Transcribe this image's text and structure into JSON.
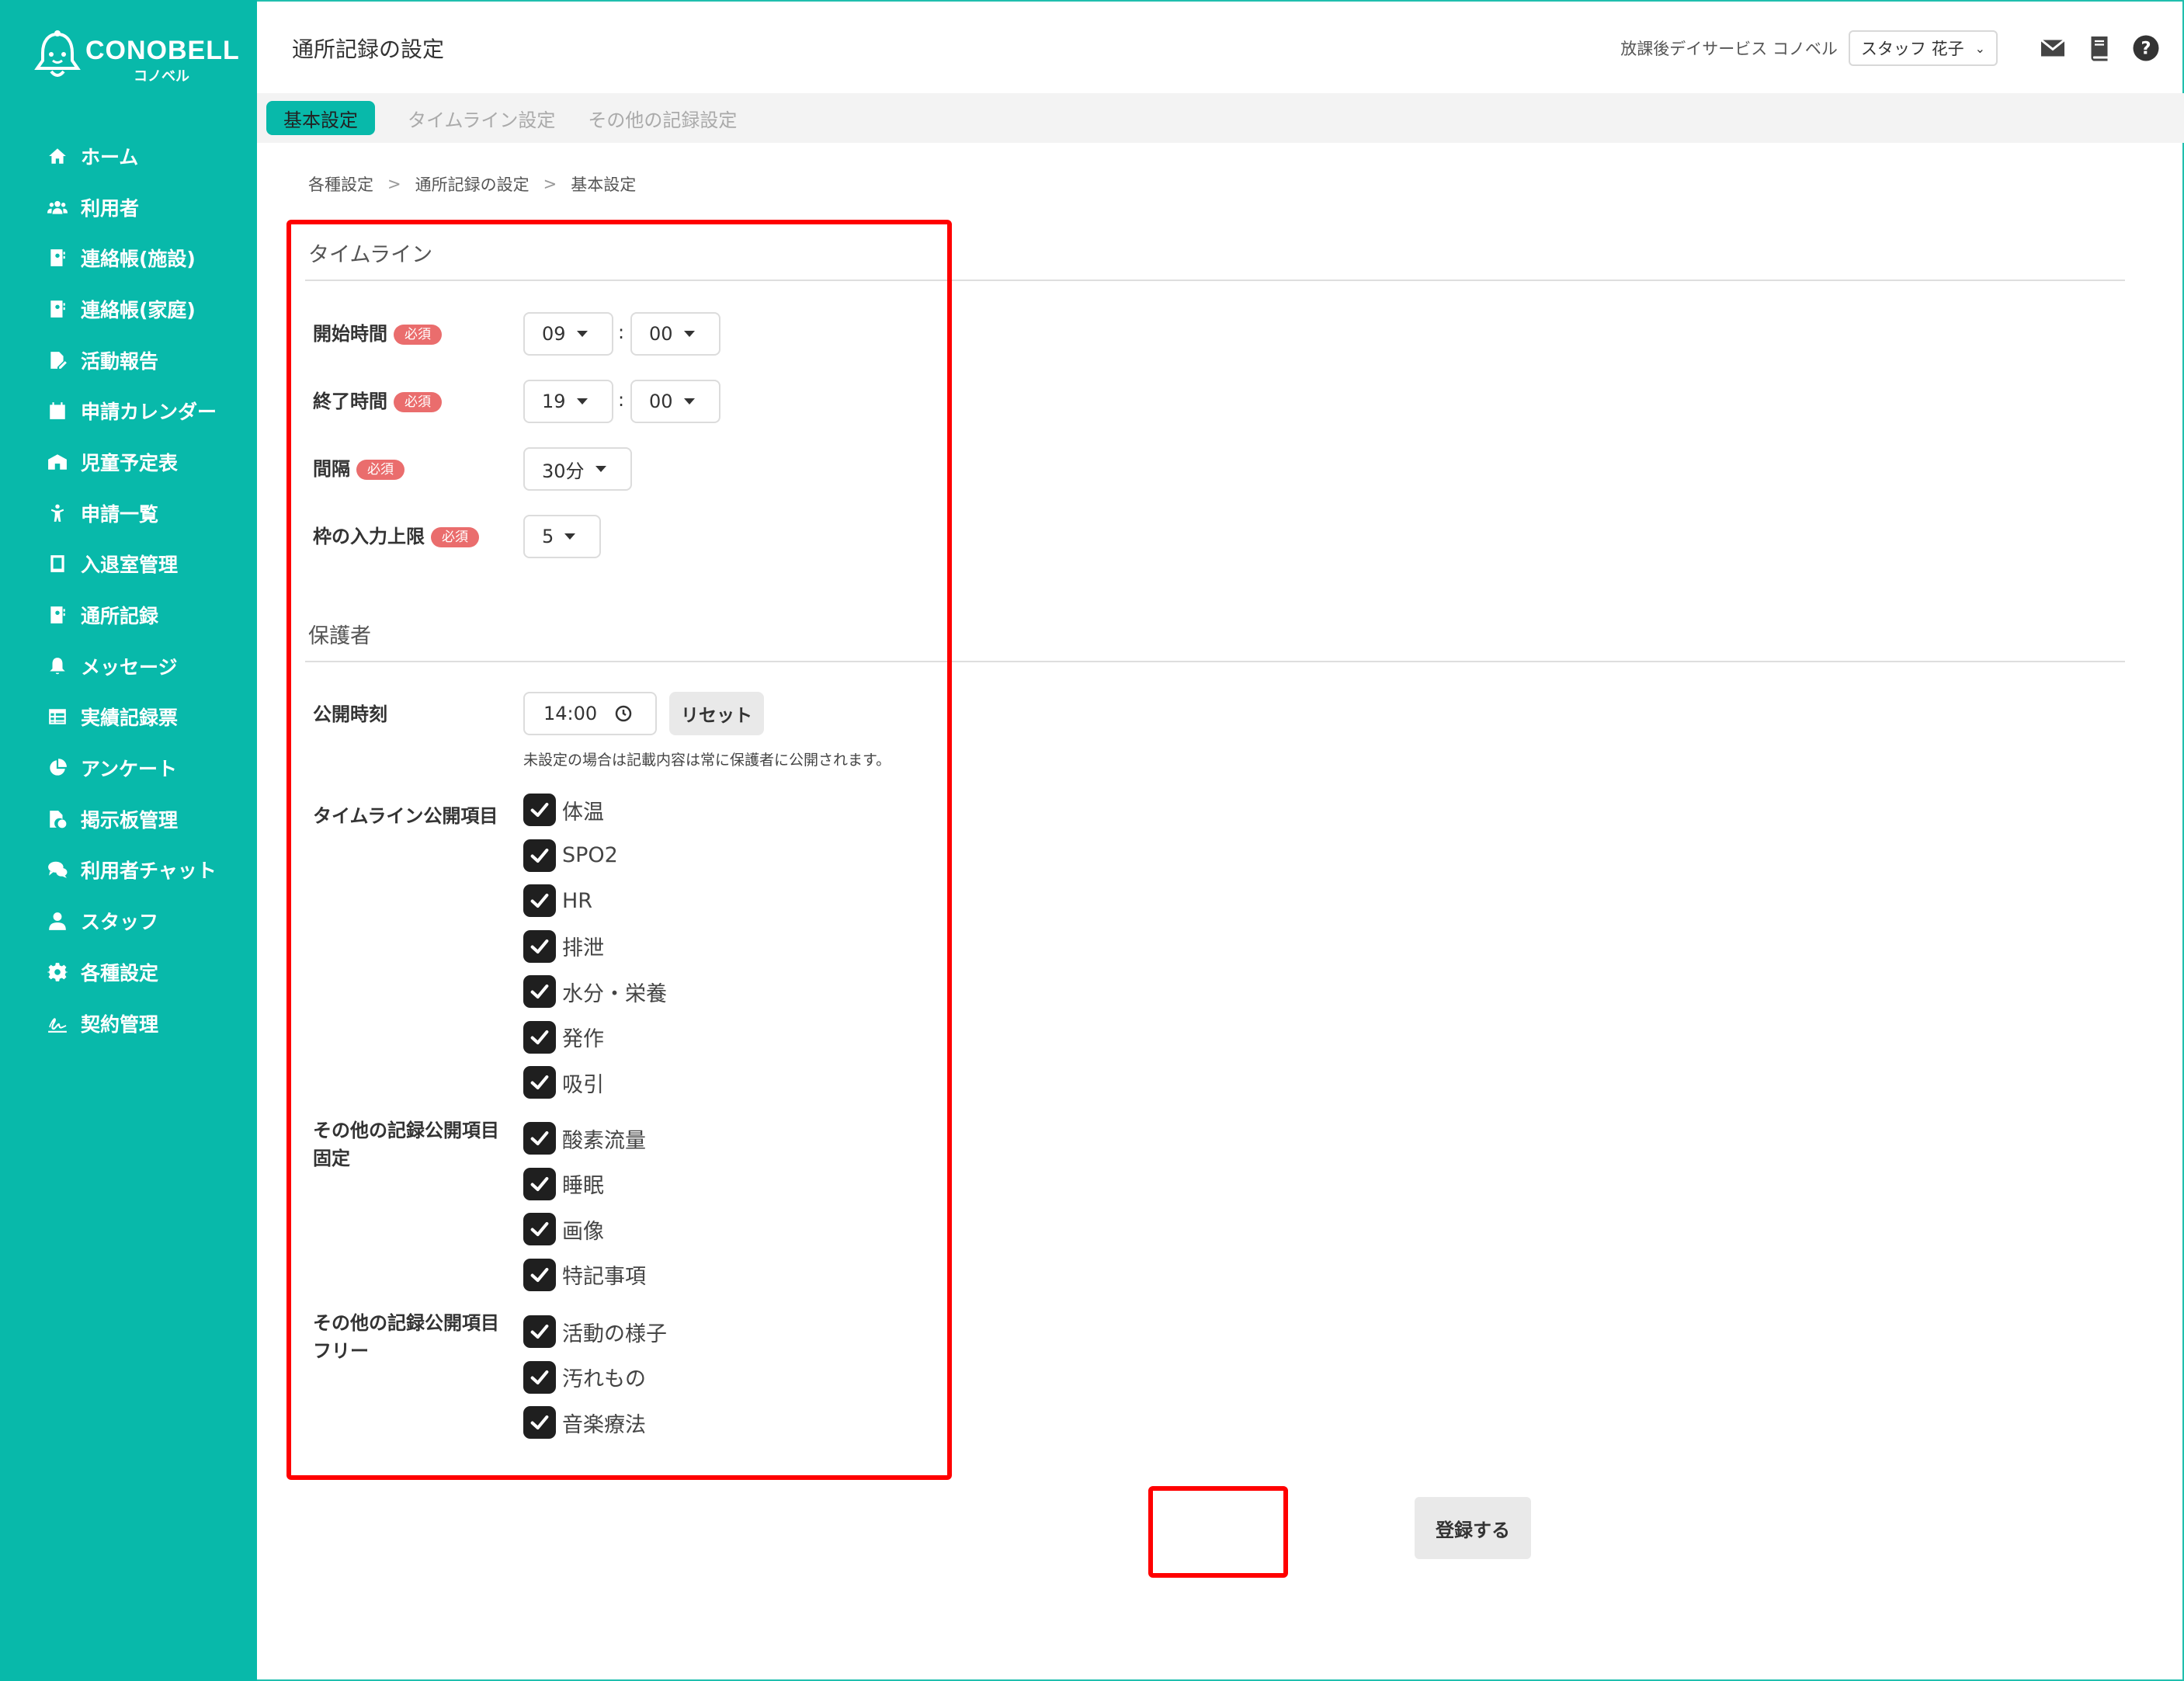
{
  "app": {
    "brand": "CONOBELL",
    "brand_sub": "コノベル",
    "page_title": "通所記録の設定",
    "facility": "放課後デイサービス コノベル",
    "staff": "スタッフ 花子"
  },
  "sidebar": {
    "items": [
      {
        "label": "ホーム",
        "icon": "home-icon"
      },
      {
        "label": "利用者",
        "icon": "users-icon"
      },
      {
        "label": "連絡帳(施設)",
        "icon": "contact-book-icon"
      },
      {
        "label": "連絡帳(家庭)",
        "icon": "contact-book-icon"
      },
      {
        "label": "活動報告",
        "icon": "file-edit-icon"
      },
      {
        "label": "申請カレンダー",
        "icon": "calendar-icon"
      },
      {
        "label": "児童予定表",
        "icon": "building-icon"
      },
      {
        "label": "申請一覧",
        "icon": "child-icon"
      },
      {
        "label": "入退室管理",
        "icon": "tablet-icon"
      },
      {
        "label": "通所記録",
        "icon": "contact-book-icon"
      },
      {
        "label": "メッセージ",
        "icon": "bell-icon"
      },
      {
        "label": "実績記録票",
        "icon": "table-icon"
      },
      {
        "label": "アンケート",
        "icon": "pie-chart-icon"
      },
      {
        "label": "掲示板管理",
        "icon": "file-check-icon"
      },
      {
        "label": "利用者チャット",
        "icon": "chat-icon"
      },
      {
        "label": "スタッフ",
        "icon": "staff-icon"
      },
      {
        "label": "各種設定",
        "icon": "gear-icon"
      },
      {
        "label": "契約管理",
        "icon": "signature-icon"
      }
    ]
  },
  "tabs": [
    {
      "label": "基本設定",
      "active": true
    },
    {
      "label": "タイムライン設定",
      "active": false
    },
    {
      "label": "その他の記録設定",
      "active": false
    }
  ],
  "breadcrumb": [
    "各種設定",
    "通所記録の設定",
    "基本設定"
  ],
  "required_label": "必須",
  "timeline": {
    "section_title": "タイムライン",
    "start_label": "開始時間",
    "start_hour": "09",
    "start_minute": "00",
    "end_label": "終了時間",
    "end_hour": "19",
    "end_minute": "00",
    "interval_label": "間隔",
    "interval_value": "30分",
    "limit_label": "枠の入力上限",
    "limit_value": "5",
    "colon": ":"
  },
  "guardian": {
    "section_title": "保護者",
    "publish_time_label": "公開時刻",
    "publish_time_value": "14:00",
    "reset_label": "リセット",
    "hint": "未設定の場合は記載内容は常に保護者に公開されます。",
    "timeline_items_label": "タイムライン公開項目",
    "timeline_items": [
      {
        "label": "体温",
        "checked": true
      },
      {
        "label": "SPO2",
        "checked": true
      },
      {
        "label": "HR",
        "checked": true
      },
      {
        "label": "排泄",
        "checked": true
      },
      {
        "label": "水分・栄養",
        "checked": true
      },
      {
        "label": "発作",
        "checked": true
      },
      {
        "label": "吸引",
        "checked": true
      }
    ],
    "other_fixed_label_1": "その他の記録公開項目",
    "other_fixed_label_2": "固定",
    "other_fixed_items": [
      {
        "label": "酸素流量",
        "checked": true
      },
      {
        "label": "睡眠",
        "checked": true
      },
      {
        "label": "画像",
        "checked": true
      },
      {
        "label": "特記事項",
        "checked": true
      }
    ],
    "other_free_label_1": "その他の記録公開項目",
    "other_free_label_2": "フリー",
    "other_free_items": [
      {
        "label": "活動の様子",
        "checked": true
      },
      {
        "label": "汚れもの",
        "checked": true
      },
      {
        "label": "音楽療法",
        "checked": true
      }
    ]
  },
  "submit_label": "登録する",
  "colors": {
    "sidebar": "#08b9aa",
    "required": "#ea6d6d",
    "highlight": "#ff0000",
    "checkbox": "#1f1f1f"
  }
}
